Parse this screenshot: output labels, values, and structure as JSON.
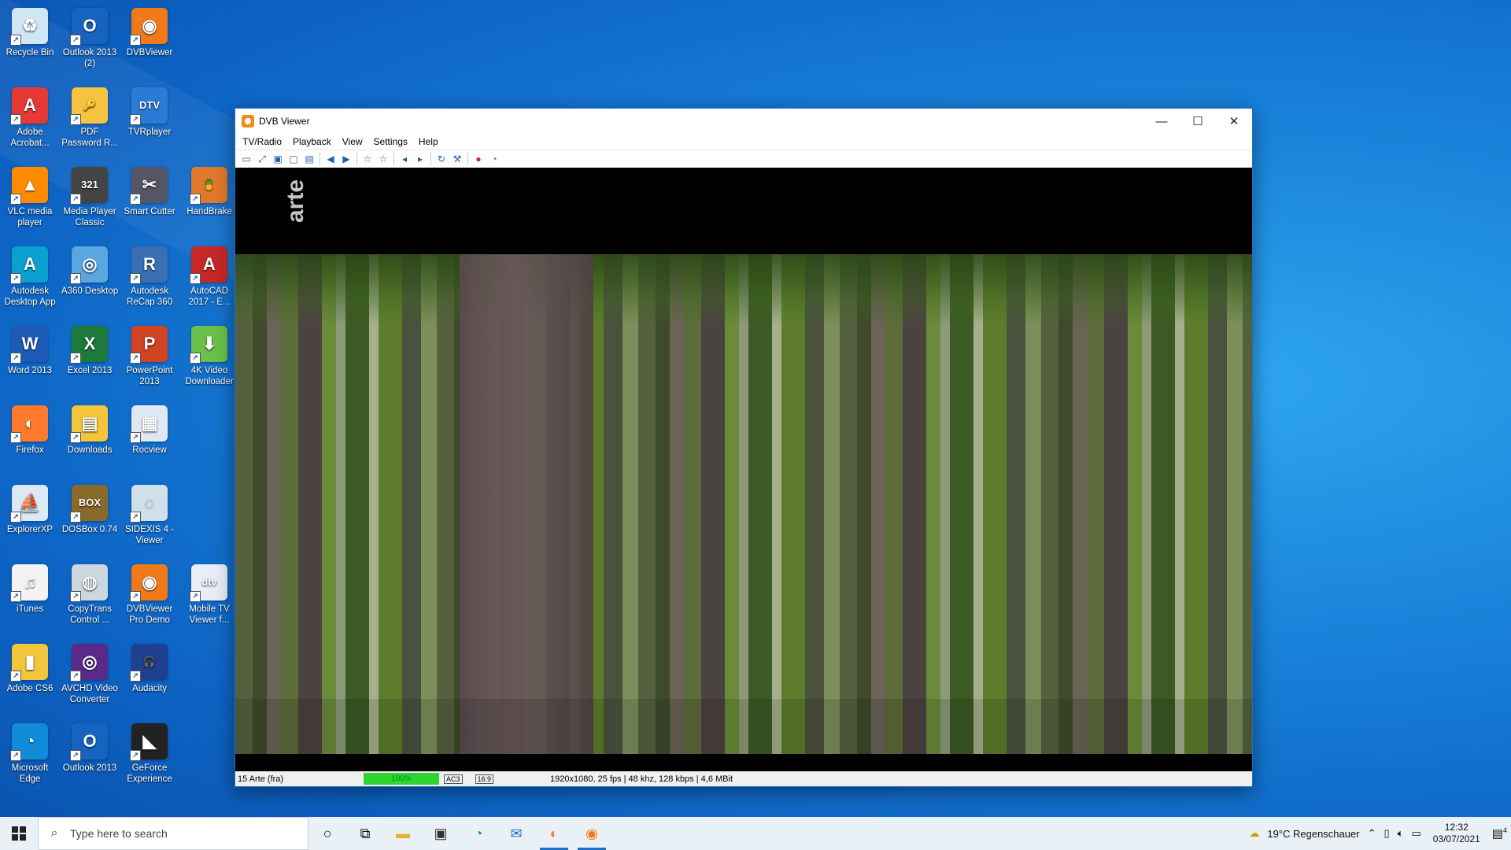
{
  "desktop": {
    "icons": [
      {
        "label": "Recycle Bin",
        "glyph": "♻",
        "color": "#cfe6f5",
        "name": "recycle-bin-icon"
      },
      {
        "label": "Outlook 2013 (2)",
        "glyph": "O",
        "color": "#1565c0",
        "name": "outlook-icon"
      },
      {
        "label": "DVBViewer",
        "glyph": "◉",
        "color": "#f07a1a",
        "name": "dvbviewer-icon"
      },
      {
        "label": "Adobe Acrobat...",
        "glyph": "A",
        "color": "#e53935",
        "name": "acrobat-icon"
      },
      {
        "label": "PDF Password R...",
        "glyph": "🔑",
        "color": "#f5c542",
        "name": "pdf-password-icon"
      },
      {
        "label": "TVRplayer",
        "glyph": "DTV",
        "color": "#2a7bd6",
        "name": "tvrplayer-icon"
      },
      {
        "label": "VLC media player",
        "glyph": "▲",
        "color": "#ff8a00",
        "name": "vlc-icon"
      },
      {
        "label": "Media Player Classic",
        "glyph": "321",
        "color": "#444",
        "name": "mpc-icon"
      },
      {
        "label": "Smart Cutter",
        "glyph": "✂",
        "color": "#556",
        "name": "smart-cutter-icon"
      },
      {
        "label": "HandBrake",
        "glyph": "🍍",
        "color": "#e0792b",
        "name": "handbrake-icon"
      },
      {
        "label": "Autodesk Desktop App",
        "glyph": "A",
        "color": "#0aa0d0",
        "name": "autodesk-app-icon"
      },
      {
        "label": "A360 Desktop",
        "glyph": "◎",
        "color": "#5aa6e0",
        "name": "a360-icon"
      },
      {
        "label": "Autodesk ReCap 360",
        "glyph": "R",
        "color": "#3a6fb3",
        "name": "recap-icon"
      },
      {
        "label": "AutoCAD 2017 - E...",
        "glyph": "A",
        "color": "#c62828",
        "name": "autocad-icon"
      },
      {
        "label": "Word 2013",
        "glyph": "W",
        "color": "#1e5bb8",
        "name": "word-icon"
      },
      {
        "label": "Excel 2013",
        "glyph": "X",
        "color": "#1d7a3c",
        "name": "excel-icon"
      },
      {
        "label": "PowerPoint 2013",
        "glyph": "P",
        "color": "#d04423",
        "name": "powerpoint-icon"
      },
      {
        "label": "4K Video Downloader",
        "glyph": "⬇",
        "color": "#6ac04a",
        "name": "4k-video-icon"
      },
      {
        "label": "Firefox",
        "glyph": "◐",
        "color": "#ff7a2c",
        "name": "firefox-icon"
      },
      {
        "label": "Downloads",
        "glyph": "▤",
        "color": "#f3c53b",
        "name": "downloads-icon"
      },
      {
        "label": "Rocview",
        "glyph": "▦",
        "color": "#dfe8f3",
        "name": "rocview-icon"
      },
      {
        "label": "ExplorerXP",
        "glyph": "⛵",
        "color": "#dbe9f7",
        "name": "explorerxp-icon"
      },
      {
        "label": "DOSBox 0.74",
        "glyph": "BOX",
        "color": "#8a6a2a",
        "name": "dosbox-icon"
      },
      {
        "label": "SIDEXIS 4 - Viewer",
        "glyph": "◌",
        "color": "#cfe0ea",
        "name": "sidexis-icon"
      },
      {
        "label": "iTunes",
        "glyph": "♫",
        "color": "#f4f4f4",
        "name": "itunes-icon"
      },
      {
        "label": "CopyTrans Control ...",
        "glyph": "◍",
        "color": "#cdd7de",
        "name": "copytrans-icon"
      },
      {
        "label": "DVBViewer Pro Demo",
        "glyph": "◉",
        "color": "#f07a1a",
        "name": "dvbviewer-pro-icon"
      },
      {
        "label": "Mobile TV Viewer f...",
        "glyph": "dtv",
        "color": "#e8eef5",
        "name": "mobile-tv-icon"
      },
      {
        "label": "Adobe CS6",
        "glyph": "▮",
        "color": "#f3c53b",
        "name": "adobe-cs6-icon"
      },
      {
        "label": "AVCHD Video Converter",
        "glyph": "◎",
        "color": "#5a2a8a",
        "name": "avchd-icon"
      },
      {
        "label": "Audacity",
        "glyph": "🎧",
        "color": "#1f3f8f",
        "name": "audacity-icon"
      },
      {
        "label": "Microsoft Edge",
        "glyph": "◔",
        "color": "#0f8bd8",
        "name": "edge-icon"
      },
      {
        "label": "Outlook 2013",
        "glyph": "O",
        "color": "#1565c0",
        "name": "outlook-2013-icon"
      },
      {
        "label": "GeForce Experience",
        "glyph": "◣",
        "color": "#222",
        "name": "geforce-icon"
      }
    ]
  },
  "window": {
    "title": "DVB Viewer",
    "menu": [
      "TV/Radio",
      "Playback",
      "View",
      "Settings",
      "Help"
    ],
    "toolbar_icons": [
      "window-icon",
      "fullscreen-icon",
      "desktop-icon",
      "snapshot-icon",
      "osd-icon",
      "back-icon",
      "forward-icon",
      "favorite-icon",
      "favorite-add-icon",
      "volume-down-icon",
      "volume-up-icon",
      "refresh-icon",
      "tools-icon",
      "record-icon",
      "timer-icon"
    ],
    "logo_text": "arte",
    "status": {
      "channel": "15 Arte (fra)",
      "signal": "100%",
      "audio_badge": "AC3",
      "aspect_badge": "16:9",
      "info": "1920x1080, 25 fps | 48 khz, 128 kbps | 4,6 MBit"
    }
  },
  "taskbar": {
    "search_placeholder": "Type here to search",
    "weather": "19°C  Regenschauer",
    "time": "12:32",
    "date": "03/07/2021",
    "notification_count": "4"
  }
}
